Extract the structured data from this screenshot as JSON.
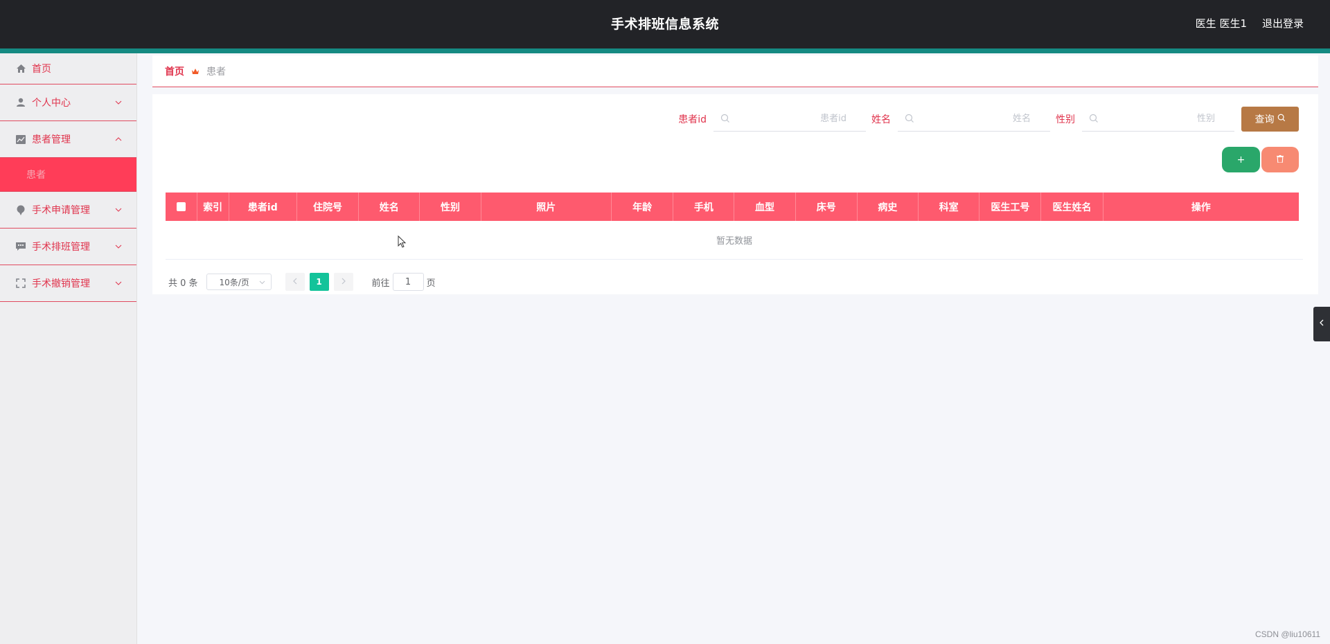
{
  "header": {
    "title": "手术排班信息系统",
    "user_role": "医生",
    "user_name": "医生1",
    "logout_label": "退出登录"
  },
  "sidebar": {
    "items": [
      {
        "label": "首页",
        "icon": "home-icon"
      },
      {
        "label": "个人中心",
        "icon": "user-icon"
      },
      {
        "label": "患者管理",
        "icon": "chart-icon",
        "expanded": true,
        "children": [
          {
            "label": "患者",
            "active": true
          }
        ]
      },
      {
        "label": "手术申请管理",
        "icon": "pin-icon"
      },
      {
        "label": "手术排班管理",
        "icon": "chat-icon"
      },
      {
        "label": "手术撤销管理",
        "icon": "fullscreen-icon"
      }
    ]
  },
  "breadcrumb": {
    "home": "首页",
    "current": "患者"
  },
  "search": {
    "fields": [
      {
        "label": "患者id",
        "placeholder": "患者id"
      },
      {
        "label": "姓名",
        "placeholder": "姓名"
      },
      {
        "label": "性别",
        "placeholder": "性别"
      }
    ],
    "query_label": "查询"
  },
  "actions": {
    "add_label": "+",
    "delete_icon": "trash-icon"
  },
  "table": {
    "columns": [
      "索引",
      "患者id",
      "住院号",
      "姓名",
      "性别",
      "照片",
      "年龄",
      "手机",
      "血型",
      "床号",
      "病史",
      "科室",
      "医生工号",
      "医生姓名",
      "操作"
    ],
    "rows": [],
    "empty_text": "暂无数据"
  },
  "pagination": {
    "total_text": "共 0 条",
    "page_size": "10条/页",
    "current_page": "1",
    "goto_prefix": "前往",
    "goto_value": "1",
    "goto_suffix": "页"
  },
  "watermark": "CSDN @liu10611",
  "colors": {
    "header_bg": "#222327",
    "accent_stripe": "#158a82",
    "primary_red": "#e0344d",
    "table_header": "#fe5a6e",
    "active_menu": "#ff3d58",
    "query_button": "#b77945",
    "add_button": "#2aa76a",
    "delete_button": "#f78a72",
    "page_active": "#13c39a"
  }
}
